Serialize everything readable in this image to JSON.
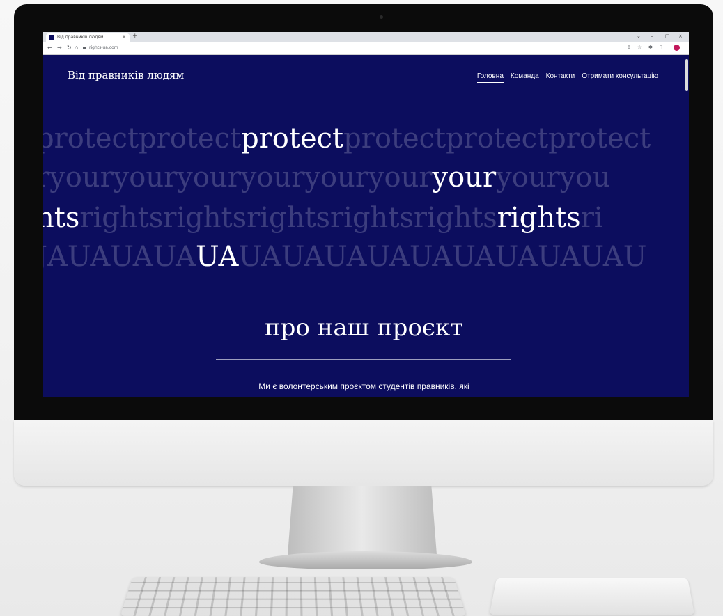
{
  "browser": {
    "tab_title": "Від правників людям",
    "new_tab": "+",
    "tab_close": "×",
    "url": "rights-ua.com",
    "window_controls": [
      "⌄",
      "–",
      "□",
      "×"
    ]
  },
  "site": {
    "brand": "Від правників людям",
    "nav": [
      "Головна",
      "Команда",
      "Контакти",
      "Отримати консультацію"
    ],
    "active_nav": "Головна"
  },
  "hero_rows": [
    {
      "pre": "protectprotect",
      "hl": "protect",
      "post": "protectprotectprotect"
    },
    {
      "pre": "ryouryouryouryouryouryour",
      "hl": "your",
      "post": "youryou"
    },
    {
      "pre": "",
      "hl": "nts",
      "mid": "rightsrightsrightsrightsrights",
      "hl2": "rights",
      "post": "ri"
    },
    {
      "pre": "JAUAUAUA",
      "hl": "UA",
      "post": "UAUAUAUAUAUAUAUAUAU"
    }
  ],
  "about": {
    "title": "про наш проєкт",
    "text": "Ми є волонтерським проєктом студентів правників, які"
  },
  "colors": {
    "page_bg": "#0c0d5e",
    "text": "#ffffff"
  }
}
